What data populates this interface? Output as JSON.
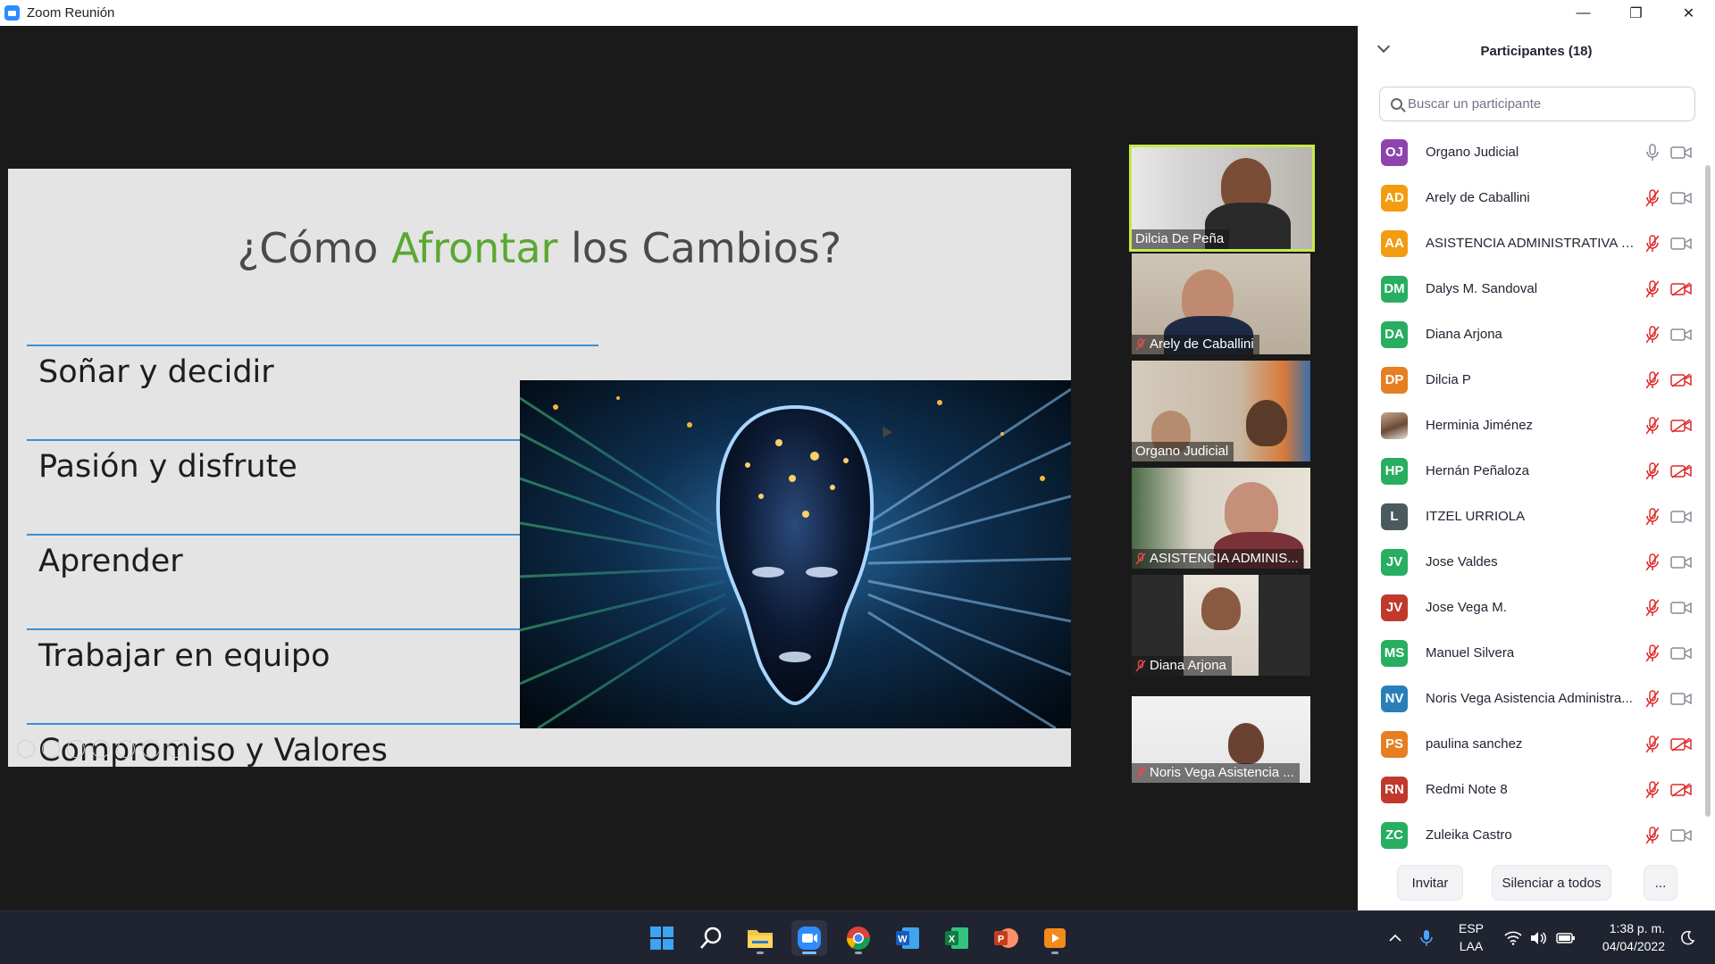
{
  "window": {
    "title": "Zoom Reunión",
    "minimize_label": "—",
    "restore_label": "❐",
    "close_label": "✕"
  },
  "slide": {
    "title_before": "¿Cómo ",
    "title_accent": "Afrontar",
    "title_after": " los Cambios?",
    "items": [
      "Soñar y decidir",
      "Pasión y disfrute",
      "Aprender",
      "Trabajar en equipo",
      "Compromiso y Valores"
    ],
    "accent_color": "#5aa832",
    "line_color": "#3b8fd6"
  },
  "tiles": [
    {
      "name": "Dilcia De Peña",
      "muted": false,
      "active": true
    },
    {
      "name": "Arely de Caballini",
      "muted": true,
      "active": false
    },
    {
      "name": "Organo Judicial",
      "muted": false,
      "active": false
    },
    {
      "name": "ASISTENCIA ADMINIS...",
      "muted": true,
      "active": false
    },
    {
      "name": "Diana Arjona",
      "muted": true,
      "active": false
    },
    {
      "name": "Noris Vega Asistencia ...",
      "muted": true,
      "active": false
    }
  ],
  "panel": {
    "title": "Participantes (18)",
    "search_placeholder": "Buscar un participante",
    "participants": [
      {
        "initials": "OJ",
        "name": "Organo Judicial",
        "color": "#8e44ad",
        "mic_muted": false,
        "cam_off": false
      },
      {
        "initials": "AD",
        "name": "Arely de Caballini",
        "color": "#f39c12",
        "mic_muted": true,
        "cam_off": false
      },
      {
        "initials": "AA",
        "name": "ASISTENCIA ADMINISTRATIVA D...",
        "color": "#f39c12",
        "mic_muted": true,
        "cam_off": false
      },
      {
        "initials": "DM",
        "name": "Dalys M. Sandoval",
        "color": "#27ae60",
        "mic_muted": true,
        "cam_off": true
      },
      {
        "initials": "DA",
        "name": "Diana Arjona",
        "color": "#27ae60",
        "mic_muted": true,
        "cam_off": false
      },
      {
        "initials": "DP",
        "name": "Dilcia P",
        "color": "#e67e22",
        "mic_muted": true,
        "cam_off": true
      },
      {
        "initials": "",
        "name": "Herminia Jiménez",
        "color": "",
        "mic_muted": true,
        "cam_off": true
      },
      {
        "initials": "HP",
        "name": "Hernán Peñaloza",
        "color": "#27ae60",
        "mic_muted": true,
        "cam_off": true
      },
      {
        "initials": "L",
        "name": "ITZEL URRIOLA",
        "color": "#4a5a5f",
        "mic_muted": true,
        "cam_off": false
      },
      {
        "initials": "JV",
        "name": "Jose Valdes",
        "color": "#27ae60",
        "mic_muted": true,
        "cam_off": false
      },
      {
        "initials": "JV",
        "name": "Jose Vega M.",
        "color": "#c0392b",
        "mic_muted": true,
        "cam_off": false
      },
      {
        "initials": "MS",
        "name": "Manuel Silvera",
        "color": "#27ae60",
        "mic_muted": true,
        "cam_off": false
      },
      {
        "initials": "NV",
        "name": "Noris Vega Asistencia Administra...",
        "color": "#2980b9",
        "mic_muted": true,
        "cam_off": false
      },
      {
        "initials": "PS",
        "name": "paulina sanchez",
        "color": "#e67e22",
        "mic_muted": true,
        "cam_off": true
      },
      {
        "initials": "RN",
        "name": "Redmi Note 8",
        "color": "#c0392b",
        "mic_muted": true,
        "cam_off": true
      },
      {
        "initials": "ZC",
        "name": "Zuleika Castro",
        "color": "#27ae60",
        "mic_muted": true,
        "cam_off": false
      }
    ],
    "invite_label": "Invitar",
    "mute_all_label": "Silenciar a todos",
    "more_label": "..."
  },
  "taskbar": {
    "apps": [
      "start-icon",
      "search-icon",
      "file-explorer-icon",
      "zoom-icon",
      "chrome-icon",
      "word-icon",
      "excel-icon",
      "powerpoint-icon",
      "media-player-icon"
    ],
    "lang_top": "ESP",
    "lang_bottom": "LAA",
    "time": "1:38 p. m.",
    "date": "04/04/2022"
  }
}
